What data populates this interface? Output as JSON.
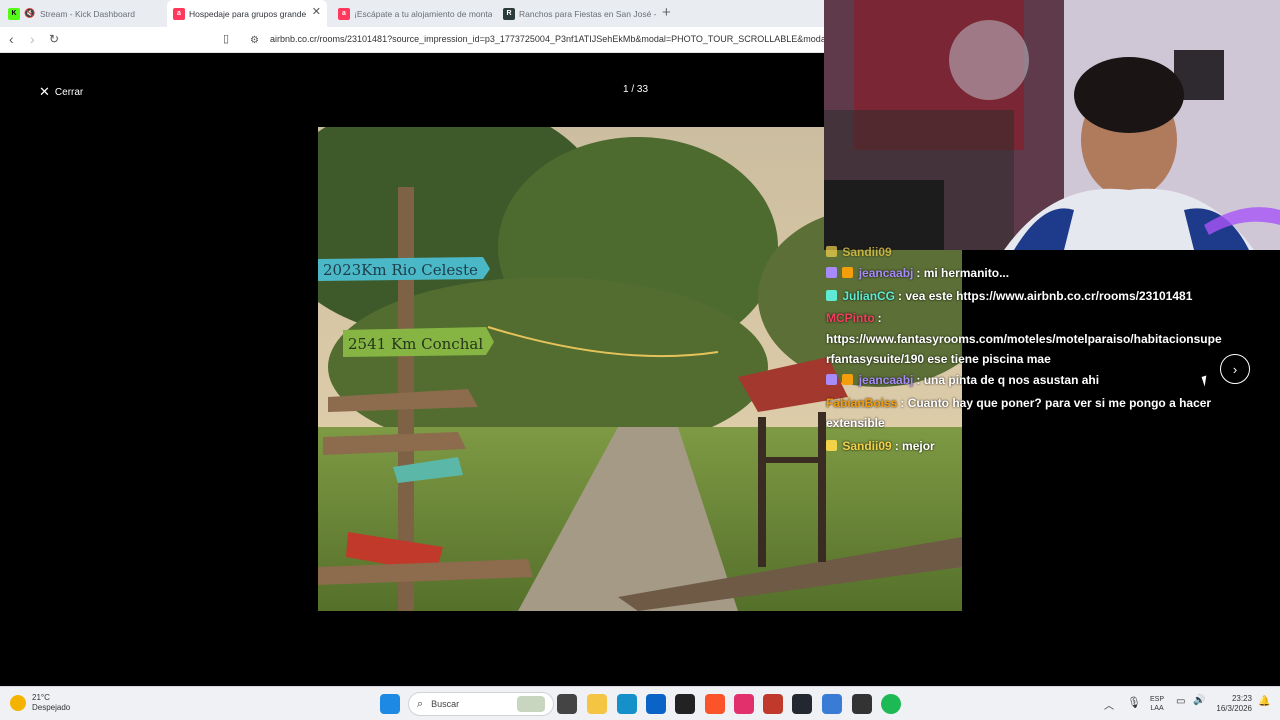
{
  "browser": {
    "tabs": [
      {
        "title": "Stream - Kick Dashboard",
        "fav_color": "#53fc18",
        "fav_letter": "K"
      },
      {
        "title": "Hospedaje para grupos grande",
        "fav_color": "#ff385c",
        "fav_letter": "a"
      },
      {
        "title": "¡Escápate a tu alojamiento de monta",
        "fav_color": "#ff385c",
        "fav_letter": "a"
      },
      {
        "title": "Ranchos para Fiestas en San José - P",
        "fav_color": "#2a3b3a",
        "fav_letter": "R"
      }
    ],
    "new_tab_symbol": "+",
    "url": "airbnb.co.cr/rooms/23101481?source_impression_id=p3_1773725004_P3nf1ATIJSehEkMb&modal=PHOTO_TOUR_SCROLLABLE&modal"
  },
  "viewer": {
    "close_label": "Cerrar",
    "counter": "1 / 33",
    "signs": [
      "2023Km Rio Celeste",
      "2541 Km Conchal"
    ]
  },
  "chat": [
    {
      "user": "Sandii09",
      "text": "",
      "color": "#f3d24a"
    },
    {
      "user": "jeancaabj",
      "text": ": mi hermanito...",
      "color": "#a78bfa"
    },
    {
      "user": "JulianCG",
      "text": ": vea este https://www.airbnb.co.cr/rooms/23101481",
      "color": "#5eead4"
    },
    {
      "user": "MCPinto",
      "text": ":",
      "color": "#f43f5e"
    },
    {
      "user": "",
      "text": "https://www.fantasyrooms.com/moteles/motelparaiso/habitacionsuperfantasysuite/190 ese tiene piscina mae",
      "color": "#ffffff"
    },
    {
      "user": "jeancaabj",
      "text": ": una pinta de q nos asustan ahi",
      "color": "#a78bfa"
    },
    {
      "user": "FabianBoiss",
      "text": ": Cuanto hay que poner? para ver si me pongo a hacer extensible",
      "color": "#f59e0b"
    },
    {
      "user": "Sandii09",
      "text": ": mejor",
      "color": "#f3d24a"
    }
  ],
  "taskbar": {
    "weather_temp": "21°C",
    "weather_desc": "Despejado",
    "search_placeholder": "Buscar",
    "lang_top": "ESP",
    "lang_bottom": "LAA",
    "time": "23:23",
    "date": "16/3/2026"
  }
}
